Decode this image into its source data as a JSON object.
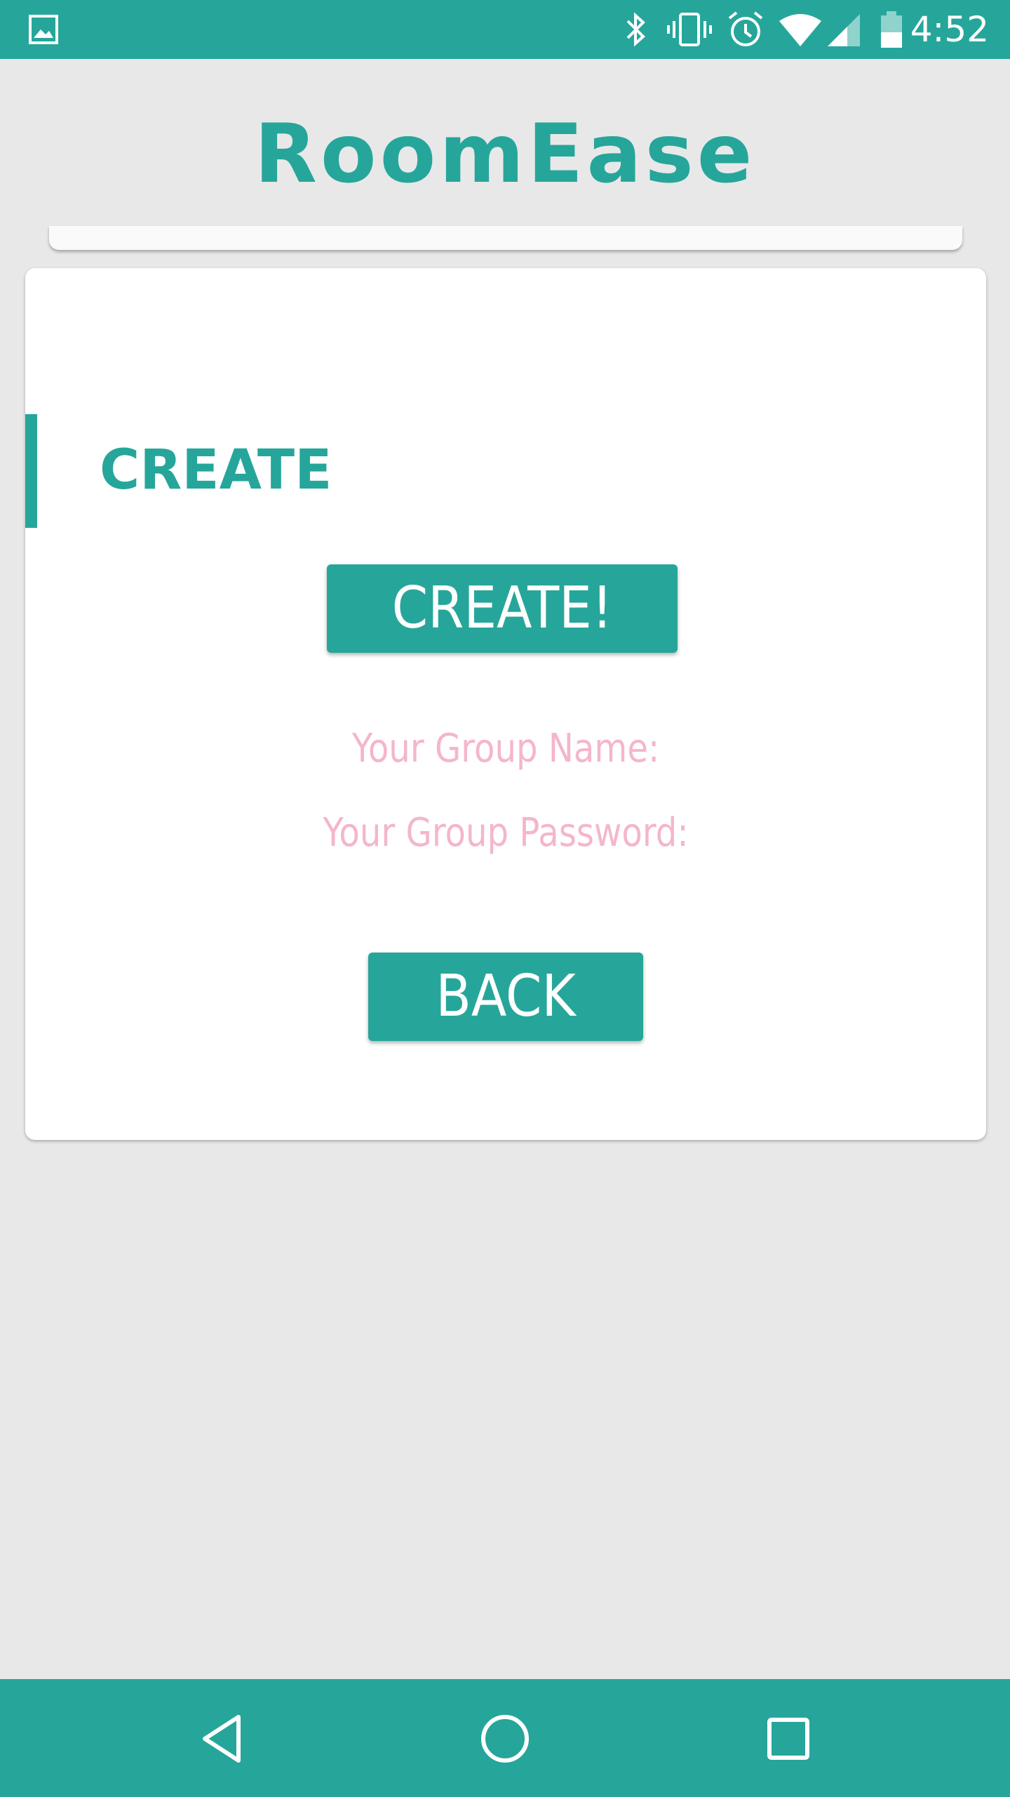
{
  "status_bar": {
    "time": "4:52",
    "icons": [
      "image-notification-icon",
      "bluetooth-icon",
      "vibrate-icon",
      "alarm-icon",
      "wifi-icon",
      "cell-signal-icon",
      "battery-icon"
    ]
  },
  "app": {
    "title": "RoomEase"
  },
  "card": {
    "heading": "CREATE",
    "create_button_label": "CREATE!",
    "group_name_label": "Your Group Name:",
    "group_password_label": "Your Group Password:",
    "back_button_label": "BACK"
  },
  "nav_bar": {
    "buttons": [
      "back-icon",
      "home-icon",
      "recents-icon"
    ]
  },
  "colors": {
    "primary": "#26a69a",
    "background": "#e8e8e9",
    "label_pink": "#f4b6cb",
    "card": "#ffffff"
  }
}
